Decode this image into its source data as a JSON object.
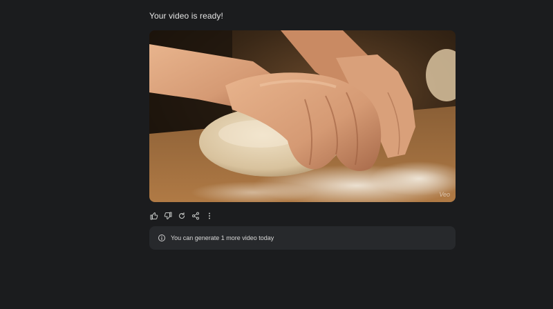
{
  "header": {
    "title": "Your video is ready!"
  },
  "video": {
    "description_icon": "kneading-dough-video",
    "watermark": "Veo"
  },
  "actions": {
    "icons": [
      "thumbs-up-icon",
      "thumbs-down-icon",
      "regenerate-icon",
      "share-icon",
      "more-options-icon"
    ]
  },
  "notice": {
    "icon": "info-icon",
    "text": "You can generate 1 more video today"
  },
  "colors": {
    "background": "#1b1c1e",
    "notice_bg": "#27292c",
    "icon": "#c4c7c5"
  }
}
